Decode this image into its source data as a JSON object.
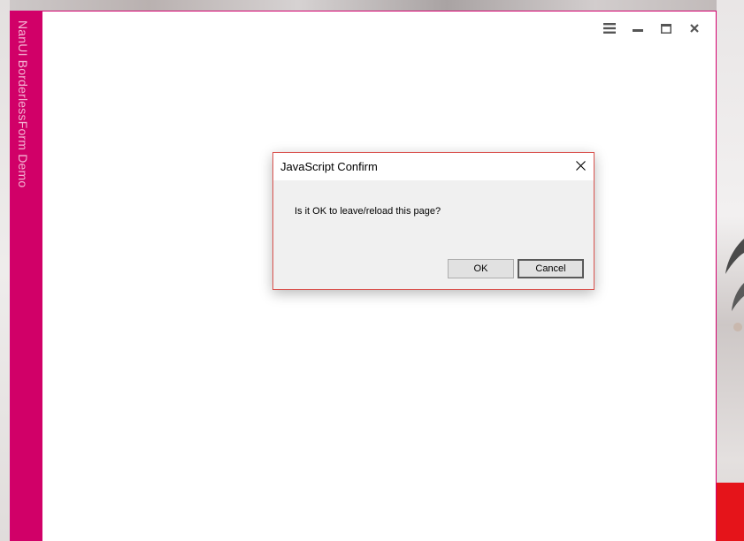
{
  "window": {
    "title": "NanUI BorderlessForm Demo",
    "accent_color": "#d10068",
    "controls": {
      "menu_icon": "hamburger-icon",
      "minimize_icon": "minimize-icon",
      "maximize_icon": "maximize-icon",
      "close_icon": "close-icon"
    }
  },
  "dialog": {
    "title": "JavaScript Confirm",
    "message": "Is it OK to leave/reload this page?",
    "ok_label": "OK",
    "cancel_label": "Cancel",
    "close_icon": "close-icon"
  }
}
